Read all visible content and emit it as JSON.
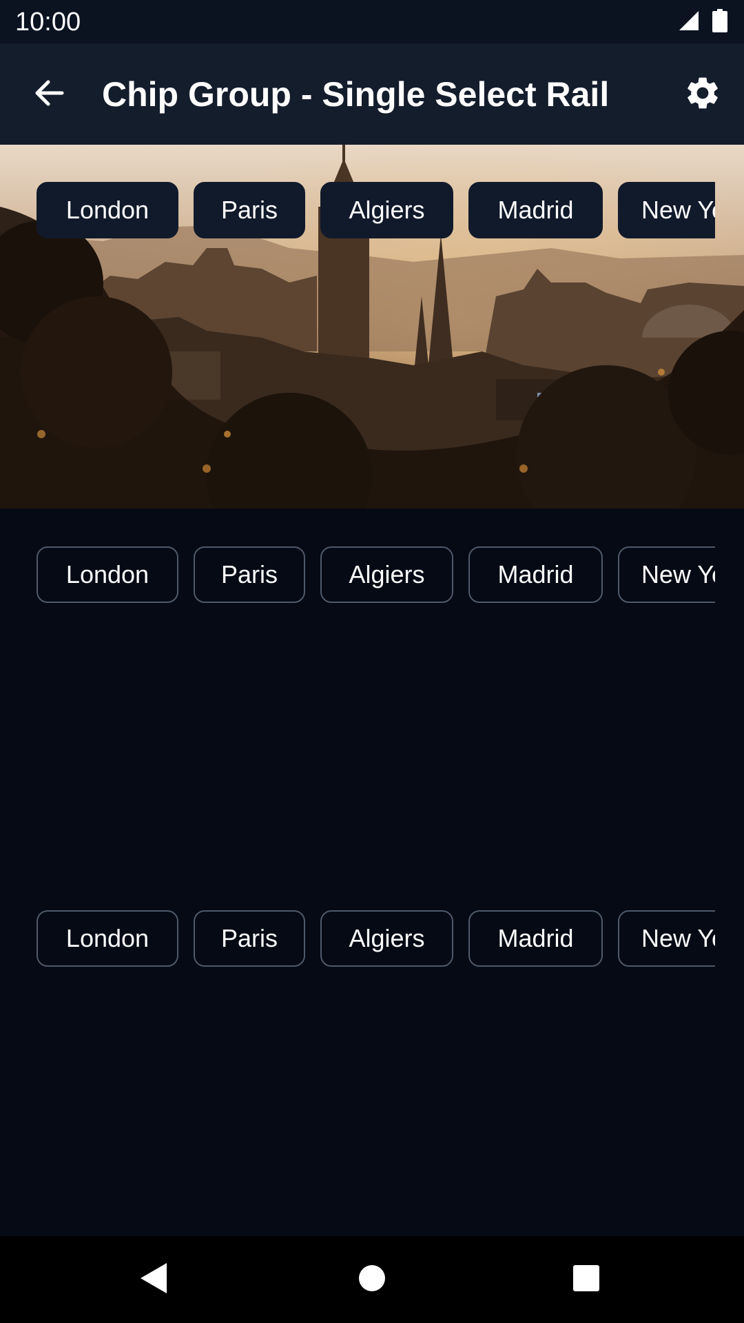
{
  "status_bar": {
    "time": "10:00",
    "icons": [
      "signal-icon",
      "battery-icon"
    ]
  },
  "app_bar": {
    "title": "Chip Group - Single Select Rail",
    "back_icon": "arrow-back-icon",
    "settings_icon": "gear-icon"
  },
  "hero": {
    "description_icon": "city-skyline-image"
  },
  "rails": [
    {
      "style": "filled",
      "chips": [
        "London",
        "Paris",
        "Algiers",
        "Madrid",
        "New York"
      ]
    },
    {
      "style": "outlined",
      "chips": [
        "London",
        "Paris",
        "Algiers",
        "Madrid",
        "New York"
      ]
    },
    {
      "style": "outlined",
      "chips": [
        "London",
        "Paris",
        "Algiers",
        "Madrid",
        "New York"
      ]
    }
  ],
  "nav_bar": {
    "icons": [
      "nav-back-icon",
      "nav-home-icon",
      "nav-recents-icon"
    ]
  },
  "colors": {
    "background": "#050a14",
    "app_bar": "#141d2c",
    "status_bar": "#0b1220",
    "chip_filled": "#111a2b",
    "chip_outline": "#4f5a6b"
  }
}
